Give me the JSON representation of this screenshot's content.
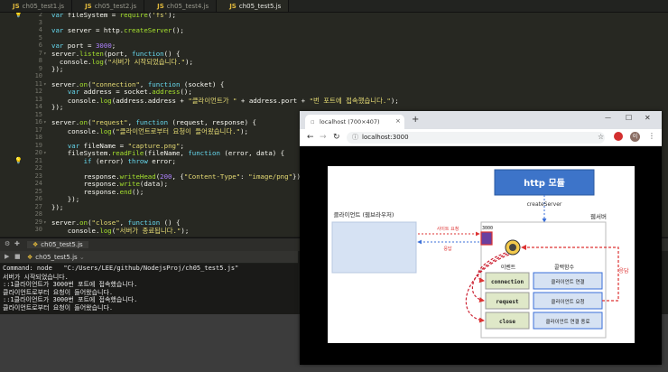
{
  "editor_tabs": [
    "ch05_test1.js",
    "ch05_test2.js",
    "ch05_test4.js",
    "ch05_test5.js"
  ],
  "active_tab": 3,
  "code_lines": [
    {
      "n": "2",
      "html": "<span class=\"kw\">var</span> fileSystem = <span class=\"fn\">require</span>(<span class=\"str\">'fs'</span>);"
    },
    {
      "n": "3",
      "html": ""
    },
    {
      "n": "4",
      "html": "<span class=\"kw\">var</span> server = http.<span class=\"fn\">createServer</span>();"
    },
    {
      "n": "5",
      "html": ""
    },
    {
      "n": "6",
      "html": "<span class=\"kw\">var</span> port = <span class=\"num\">3000</span>;"
    },
    {
      "n": "7",
      "html": "server.<span class=\"fn\">listen</span>(port, <span class=\"kw\">function</span>() {",
      "fold": true
    },
    {
      "n": "8",
      "html": "  console.<span class=\"fn\">log</span>(<span class=\"str\">\"서버가 시작되었습니다.\"</span>);"
    },
    {
      "n": "9",
      "html": "});"
    },
    {
      "n": "10",
      "html": ""
    },
    {
      "n": "11",
      "html": "server.<span class=\"fn\">on</span>(<span class=\"str\">\"connection\"</span>, <span class=\"kw\">function</span> (socket) {",
      "fold": true
    },
    {
      "n": "12",
      "html": "    <span class=\"kw\">var</span> address = socket.<span class=\"fn\">address</span>();"
    },
    {
      "n": "13",
      "html": "    console.<span class=\"fn\">log</span>(address.address + <span class=\"str\">\"클라이언트가 \"</span> + address.port + <span class=\"str\">\"번 포트에 접속했습니다.\"</span>);"
    },
    {
      "n": "14",
      "html": "});"
    },
    {
      "n": "15",
      "html": ""
    },
    {
      "n": "16",
      "html": "server.<span class=\"fn\">on</span>(<span class=\"str\">\"request\"</span>, <span class=\"kw\">function</span> (request, response) {",
      "fold": true
    },
    {
      "n": "17",
      "html": "    console.<span class=\"fn\">log</span>(<span class=\"str\">\"클라이언트로부터 요청이 들어왔습니다.\"</span>);"
    },
    {
      "n": "18",
      "html": ""
    },
    {
      "n": "19",
      "html": "    <span class=\"kw\">var</span> fileName = <span class=\"str\">\"capture.png\"</span>;"
    },
    {
      "n": "20",
      "html": "    fileSystem.<span class=\"fn\">readFile</span>(fileName, <span class=\"kw\">function</span> (error, data) {",
      "fold": true
    },
    {
      "n": "21",
      "html": "        <span class=\"kw\">if</span> (error) <span class=\"kw\">throw</span> error;",
      "bulb": true
    },
    {
      "n": "22",
      "html": ""
    },
    {
      "n": "23",
      "html": "        response.<span class=\"fn\">writeHead</span>(<span class=\"num\">200</span>, {<span class=\"str\">\"Content-Type\"</span>: <span class=\"str\">\"image/png\"</span>});"
    },
    {
      "n": "24",
      "html": "        response.<span class=\"fn\">write</span>(data);"
    },
    {
      "n": "25",
      "html": "        response.<span class=\"fn\">end</span>();"
    },
    {
      "n": "26",
      "html": "    });"
    },
    {
      "n": "27",
      "html": "});"
    },
    {
      "n": "28",
      "html": ""
    },
    {
      "n": "29",
      "html": "server.<span class=\"fn\">on</span>(<span class=\"str\">\"close\"</span>, <span class=\"kw\">function</span> () {",
      "fold": true
    },
    {
      "n": "30",
      "html": "    console.<span class=\"fn\">log</span>(<span class=\"str\">\"서버가 종료됩니다.\"</span>);"
    }
  ],
  "console": {
    "tab_top": "ch05_test5.js",
    "tab": "ch05_test5.js",
    "lines": [
      "Command: node   \"C:/Users/LEE/github/NodejsProj/ch05_test5.js\"",
      "서버가 시작되었습니다.",
      "::1클라이언트가 3000번 포트에 접속했습니다.",
      "클라이언트로부터 요청이 들어왔습니다.",
      "::1클라이언트가 3000번 포트에 접속했습니다.",
      "클라이언트로부터 요청이 들어왔습니다."
    ]
  },
  "browser": {
    "tab_title": "localhost (700×407)",
    "url": "localhost:3000",
    "new_tab": "+",
    "win_min": "—",
    "win_max": "☐",
    "win_close": "✕",
    "profile": "이"
  },
  "diagram": {
    "http_module": "http 모듈",
    "create_server": "createServer",
    "client": "클라이언트 (웹브라우저)",
    "web_server": "웹서버",
    "port": "3000",
    "site_request": "사이트 요청",
    "response_small": "응답",
    "response_big": "응답",
    "event_header": "이벤트",
    "callback_header": "콜백함수",
    "events": [
      "connection",
      "request",
      "close"
    ],
    "callbacks": [
      "클라이언트 연결",
      "클라이언트 요청",
      "클라이언트 연결 종료"
    ]
  }
}
